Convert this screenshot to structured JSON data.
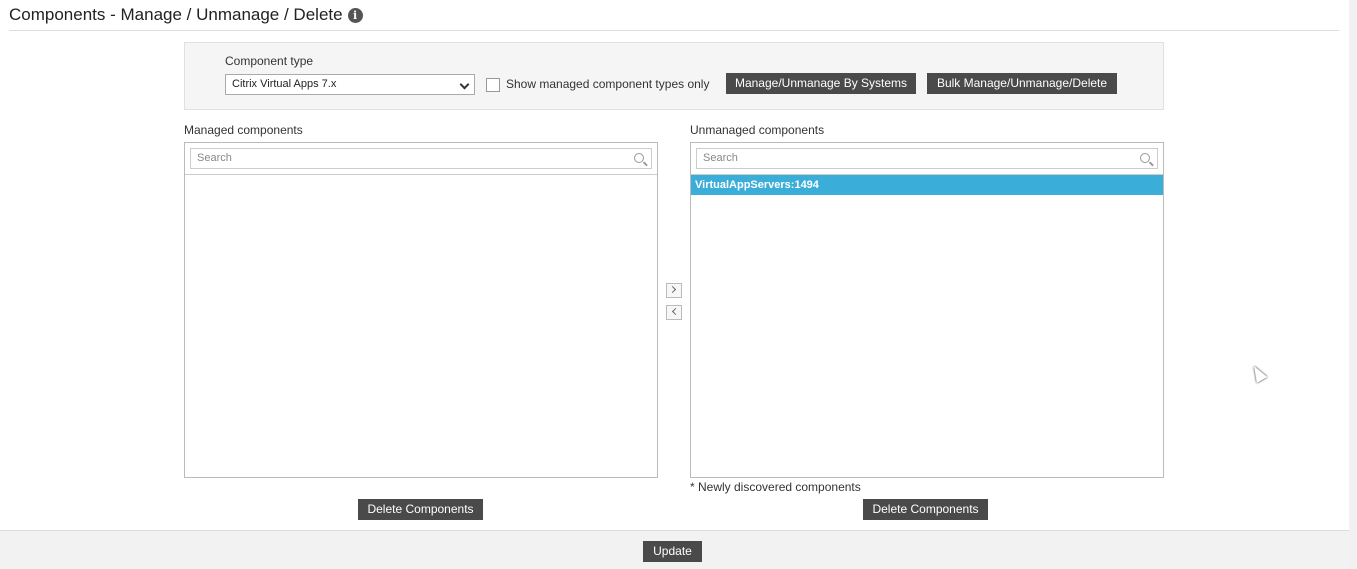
{
  "page": {
    "title": "Components - Manage / Unmanage / Delete",
    "info_icon": "info-icon"
  },
  "filter": {
    "component_type_label": "Component type",
    "component_type_value": "Citrix Virtual Apps 7.x",
    "show_managed_label": "Show managed component types only",
    "show_managed_checked": false,
    "btn_by_systems": "Manage/Unmanage By Systems",
    "btn_bulk": "Bulk Manage/Unmanage/Delete"
  },
  "managed": {
    "label": "Managed components",
    "search_placeholder": "Search",
    "items": []
  },
  "unmanaged": {
    "label": "Unmanaged components",
    "search_placeholder": "Search",
    "items": [
      "VirtualAppServers:1494"
    ],
    "note": "* Newly discovered components"
  },
  "actions": {
    "delete_label": "Delete Components",
    "update_label": "Update"
  },
  "colors": {
    "selected_row": "#3aadd9",
    "dark_button": "#4a4a4a"
  }
}
